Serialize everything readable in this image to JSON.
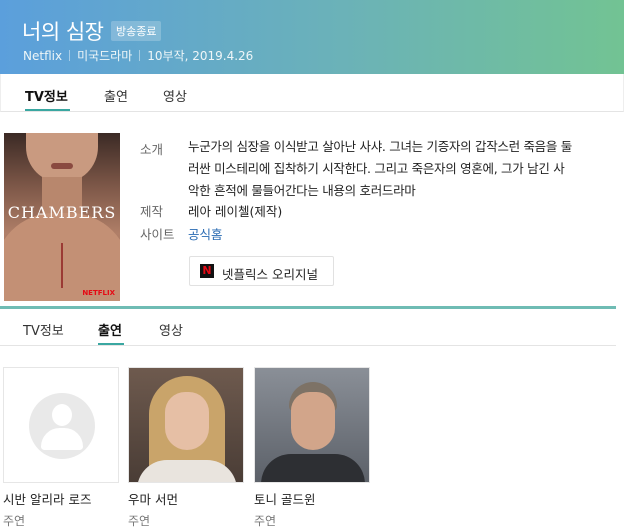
{
  "header": {
    "title": "너의 심장",
    "badge": "방송종료",
    "platform": "Netflix",
    "genre": "미국드라마",
    "info": "10부작, 2019.4.26"
  },
  "tabs_top": [
    {
      "label": "TV정보",
      "active": true
    },
    {
      "label": "출연",
      "active": false
    },
    {
      "label": "영상",
      "active": false
    }
  ],
  "poster": {
    "title": "CHAMBERS",
    "logo": "NETFLIX"
  },
  "info": {
    "intro_label": "소개",
    "intro_lines": [
      "누군가의 심장을 이식받고 살아난 사샤. 그녀는 기증자의 갑작스런 죽음을 둘",
      "러싼 미스테리에 집착하기 시작한다. 그리고 죽은자의 영혼에, 그가 남긴 사",
      "악한 흔적에 물들어간다는 내용의 호러드라마"
    ],
    "production_label": "제작",
    "production_value": "레아 레이첼(제작)",
    "site_label": "사이트",
    "site_value": "공식홈"
  },
  "netflix_button": {
    "icon": "netflix-n-icon",
    "label": "넷플릭스 오리지널"
  },
  "tabs_bottom": [
    {
      "label": "TV정보",
      "active": false
    },
    {
      "label": "출연",
      "active": true
    },
    {
      "label": "영상",
      "active": false
    }
  ],
  "cast": [
    {
      "name": "시반 알리라 로즈",
      "role": "주연",
      "photo": "placeholder-person-icon"
    },
    {
      "name": "우마 서먼",
      "role": "주연",
      "photo": "photo"
    },
    {
      "name": "토니 골드윈",
      "role": "주연",
      "photo": "photo"
    }
  ],
  "colors": {
    "header_gradient_start": "#5b9fdc",
    "header_gradient_end": "#72c393",
    "accent": "#3aa7a1",
    "link": "#2a6bb3",
    "netflix_red": "#e50914"
  }
}
